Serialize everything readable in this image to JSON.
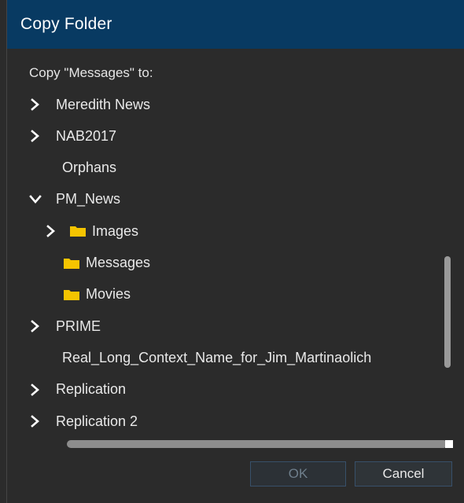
{
  "dialog": {
    "title": "Copy Folder",
    "prompt": "Copy \"Messages\" to:"
  },
  "tree": {
    "items": [
      {
        "label": "Meredith News",
        "expander": "collapsed",
        "folder": false
      },
      {
        "label": "NAB2017",
        "expander": "collapsed",
        "folder": false
      },
      {
        "label": "Orphans",
        "expander": "none",
        "folder": false
      },
      {
        "label": "PM_News",
        "expander": "expanded",
        "folder": false
      },
      {
        "label": "Images",
        "expander": "collapsed",
        "folder": true
      },
      {
        "label": "Messages",
        "expander": "none",
        "folder": true
      },
      {
        "label": "Movies",
        "expander": "none",
        "folder": true
      },
      {
        "label": "PRIME",
        "expander": "collapsed",
        "folder": false
      },
      {
        "label": "Real_Long_Context_Name_for_Jim_Martinaolich",
        "expander": "none",
        "folder": false
      },
      {
        "label": "Replication",
        "expander": "collapsed",
        "folder": false
      },
      {
        "label": "Replication 2",
        "expander": "collapsed",
        "folder": false
      }
    ]
  },
  "buttons": {
    "ok_label": "OK",
    "ok_enabled": false,
    "cancel_label": "Cancel"
  },
  "icons": {
    "expand": "chevron-right-icon",
    "collapse": "chevron-down-icon",
    "folder": "folder-icon"
  },
  "colors": {
    "title_bar": "#083a62",
    "background": "#2b2b2b",
    "folder": "#f5c400",
    "text": "#e9e9e9"
  }
}
